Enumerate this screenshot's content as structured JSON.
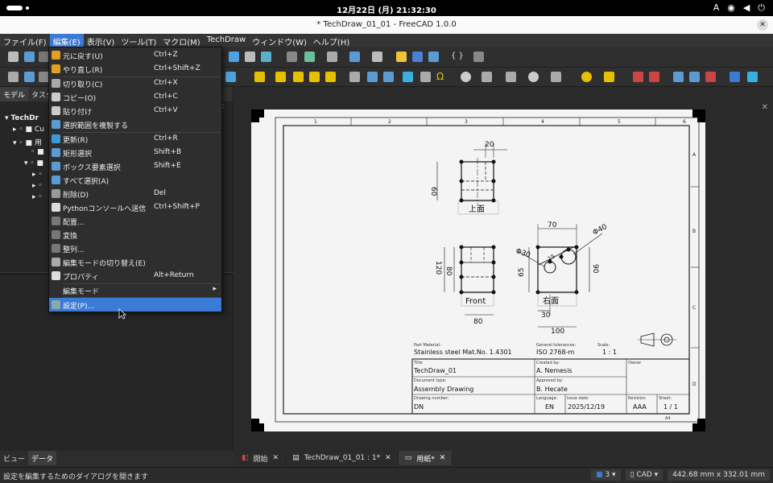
{
  "system": {
    "clock": "12月22日 (月)  21:32:30",
    "input_method": "A"
  },
  "window": {
    "title": "* TechDraw_01_01 - FreeCAD 1.0.0"
  },
  "menubar": [
    "ファイル(F)",
    "編集(E)",
    "表示(V)",
    "ツール(T)",
    "マクロ(M)",
    "TechDraw",
    "ウィンドウ(W)",
    "ヘルプ(H)"
  ],
  "edit_menu": [
    {
      "label": "元に戻す(U)",
      "shortcut": "Ctrl+Z",
      "icon": "undo-icon"
    },
    {
      "label": "やり直し(R)",
      "shortcut": "Ctrl+Shift+Z",
      "icon": "redo-icon"
    },
    {
      "sep": true
    },
    {
      "label": "切り取り(C)",
      "shortcut": "Ctrl+X",
      "icon": "cut-icon"
    },
    {
      "label": "コピー(O)",
      "shortcut": "Ctrl+C",
      "icon": "copy-icon"
    },
    {
      "label": "貼り付け",
      "shortcut": "Ctrl+V",
      "icon": "paste-icon"
    },
    {
      "label": "選択範囲を複製する",
      "shortcut": "",
      "icon": "duplicate-icon"
    },
    {
      "sep": true
    },
    {
      "label": "更新(R)",
      "shortcut": "Ctrl+R",
      "icon": "refresh-icon"
    },
    {
      "label": "矩形選択",
      "shortcut": "Shift+B",
      "icon": "box-select-icon"
    },
    {
      "label": "ボックス要素選択",
      "shortcut": "Shift+E",
      "icon": "element-select-icon"
    },
    {
      "label": "すべて選択(A)",
      "shortcut": "",
      "icon": "select-all-icon"
    },
    {
      "label": "削除(D)",
      "shortcut": "Del",
      "icon": "delete-icon"
    },
    {
      "label": "Pythonコンソールへ送信",
      "shortcut": "Ctrl+Shift+P",
      "icon": "python-icon"
    },
    {
      "label": "配置...",
      "shortcut": "",
      "icon": "placement-icon"
    },
    {
      "label": "変換",
      "shortcut": "",
      "icon": "transform-icon"
    },
    {
      "label": "整列...",
      "shortcut": "",
      "icon": "align-icon"
    },
    {
      "label": "編集モードの切り替え(E)",
      "shortcut": "",
      "icon": "edit-mode-icon"
    },
    {
      "label": "プロパティ",
      "shortcut": "Alt+Return",
      "icon": "properties-icon"
    },
    {
      "sep": true
    },
    {
      "label": "編集モード",
      "shortcut": "",
      "icon": "",
      "submenu": true
    },
    {
      "sep": true
    },
    {
      "label": "設定(P)...",
      "shortcut": "",
      "icon": "settings-icon",
      "highlighted": true
    }
  ],
  "left_panel": {
    "tabs": [
      "モデル",
      "タスク"
    ],
    "tree": [
      "TechDr",
      "Cu",
      "用",
      "",
      "",
      "",
      ""
    ],
    "bottom_tabs": [
      "ビュー",
      "データ"
    ]
  },
  "drawing": {
    "columns": [
      "1",
      "2",
      "3",
      "4",
      "5",
      "6"
    ],
    "rows": [
      "A",
      "B",
      "C",
      "D"
    ],
    "view_top_label": "上面",
    "view_front_label": "Front",
    "view_right_label": "右面",
    "dims": {
      "d20": "20",
      "d60": "60",
      "d70": "70",
      "d40": "Φ40",
      "d30": "Φ30",
      "d15": "15",
      "d120": "120",
      "d80v": "80",
      "d65": "65",
      "d90": "90",
      "d30h": "30",
      "d80": "80",
      "d100": "100"
    },
    "part_material_label": "Part Material:",
    "part_material": "Stainless steel Mat.No. 1.4301",
    "tolerances_label": "General tolerances:",
    "tolerances": "ISO 2768-m",
    "scale_label": "Scale:",
    "scale": "1 : 1",
    "title_label": "Title",
    "title": "TechDraw_01",
    "created_label": "Created by:",
    "created_by": "A. Nemesis",
    "owner_label": "Owner",
    "doctype_label": "Document type:",
    "doctype": "Assembly Drawing",
    "approved_label": "Approved by:",
    "approved_by": "B. Hecate",
    "drawno_label": "Drawing number:",
    "drawing_number": "DN",
    "language_label": "Language:",
    "language": "EN",
    "issue_label": "Issue date:",
    "issue_date": "2025/12/19",
    "revision_label": "Revision:",
    "revision": "AAA",
    "sheet_label": "Sheet:",
    "sheet": "1 / 1",
    "sheet_size": "A4"
  },
  "doc_tabs": [
    {
      "label": "開始",
      "selected": false
    },
    {
      "label": "TechDraw_01_01 : 1*",
      "selected": false
    },
    {
      "label": "用紙*",
      "selected": true
    }
  ],
  "status": {
    "message": "設定を編集するためのダイアログを開きます",
    "layer": "3",
    "nav": "CAD",
    "dimensions": "442.68 mm x 332.01 mm"
  }
}
